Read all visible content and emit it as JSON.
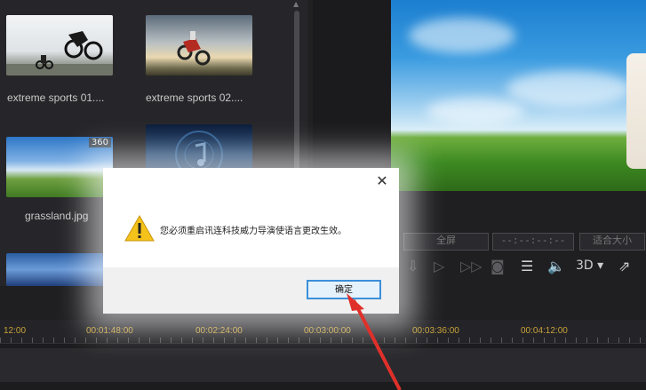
{
  "media_library": {
    "items": [
      {
        "label": "extreme sports 01...."
      },
      {
        "label": "extreme sports 02...."
      },
      {
        "label": "grassland.jpg",
        "badge": "360"
      },
      {
        "label": ""
      },
      {
        "label": ""
      }
    ]
  },
  "preview_controls": {
    "fullscreen_label": "全屏",
    "timecode": "--:--:--:--",
    "fit_label": "适合大小",
    "view_3d": "3D ▾"
  },
  "timeline": {
    "ruler_labels": [
      "12:00",
      "00:01:48:00",
      "00:02:24:00",
      "00:03:00:00",
      "00:03:36:00",
      "00:04:12:00"
    ]
  },
  "dialog": {
    "message": "您必须重启讯连科技威力导演使语言更改生效。",
    "ok_label": "确定",
    "close_glyph": "✕"
  },
  "colors": {
    "accent": "#3c8fd9",
    "ruler_text": "#c9a23a",
    "annotation_arrow": "#e0302a"
  }
}
